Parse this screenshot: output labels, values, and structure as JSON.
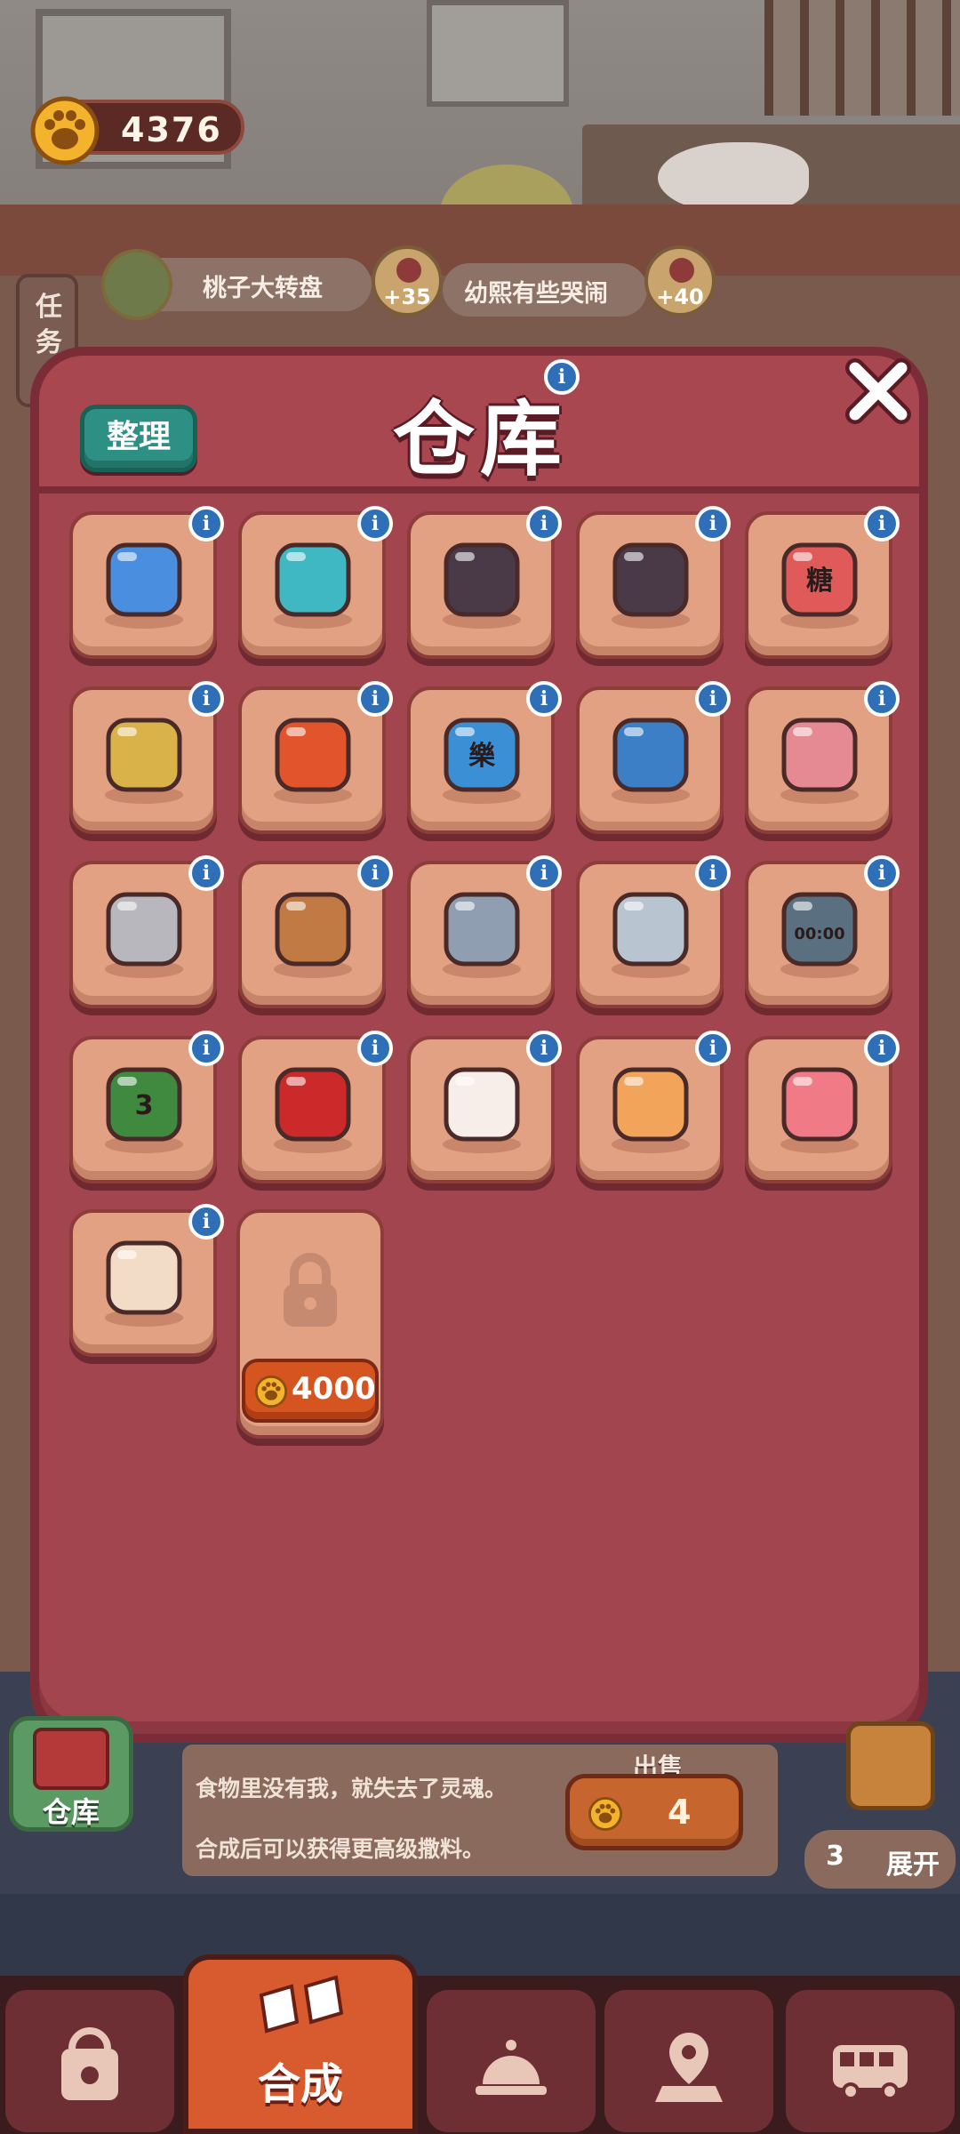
{
  "hud": {
    "coins": "4376"
  },
  "task_panel": {
    "label": "任务"
  },
  "quests": [
    {
      "title": "桃子大转盘"
    },
    {
      "title": "幼熙有些哭闹"
    }
  ],
  "rewards": [
    "+35",
    "+40"
  ],
  "modal": {
    "title": "仓库",
    "sort_label": "整理",
    "info_glyph": "i"
  },
  "items": [
    {
      "name": "blue-crystals-icon",
      "color": "#4a8ee0"
    },
    {
      "name": "battery-icon",
      "color": "#3fb8c4"
    },
    {
      "name": "sugarcane-sprout-icon",
      "color": "#4a3a48"
    },
    {
      "name": "sugarcane-leaves-icon",
      "color": "#4a3a48"
    },
    {
      "name": "sugar-jar-icon",
      "color": "#e05a5a",
      "text": "糖"
    },
    {
      "name": "soup-bowl-icon",
      "color": "#d9b24a"
    },
    {
      "name": "maple-wreath-icon",
      "color": "#e2552c"
    },
    {
      "name": "pendant-tag-icon",
      "color": "#3b8fd4",
      "text": "樂"
    },
    {
      "name": "blue-bag-icon",
      "color": "#3d7fc7"
    },
    {
      "name": "dustpan-icon",
      "color": "#e58a92"
    },
    {
      "name": "silver-ingots-icon",
      "color": "#b7b7bd"
    },
    {
      "name": "bronze-lid-icon",
      "color": "#c27a44"
    },
    {
      "name": "steel-lid-icon",
      "color": "#8f9fb1"
    },
    {
      "name": "stopwatch-icon",
      "color": "#b8c4cf"
    },
    {
      "name": "digital-timer-icon",
      "color": "#5a7080",
      "text": "00:00"
    },
    {
      "name": "calendar-pages-icon",
      "color": "#3f8a3f",
      "text": "3"
    },
    {
      "name": "screwdriver-icon",
      "color": "#cc2a2a"
    },
    {
      "name": "white-lucky-cat-icon",
      "color": "#f7eeea"
    },
    {
      "name": "orange-lucky-cat-icon",
      "color": "#f2a45a"
    },
    {
      "name": "pink-cooler-icon",
      "color": "#f07a86"
    },
    {
      "name": "storage-crate-icon",
      "color": "#f2dcc8"
    }
  ],
  "locked_slot": {
    "price": "4000"
  },
  "item_description": {
    "line1": "食物里没有我，就失去了灵魂。",
    "line2": "合成后可以获得更高级撒料。"
  },
  "sell": {
    "label": "出售",
    "price": "4"
  },
  "warehouse_tab": {
    "label": "仓库"
  },
  "expand": {
    "count": "3",
    "label": "展开"
  },
  "nav": {
    "active_label": "合成",
    "items": [
      "bag-icon",
      "merge-icon",
      "service-bell-icon",
      "map-pin-icon",
      "bus-icon"
    ]
  },
  "colors": {
    "modal_bg": "#a2454f",
    "slot_bg": "#e3a183",
    "info_blue": "#2f6fb8",
    "sort_teal": "#2e8f84",
    "nav_active": "#d85b2f"
  }
}
